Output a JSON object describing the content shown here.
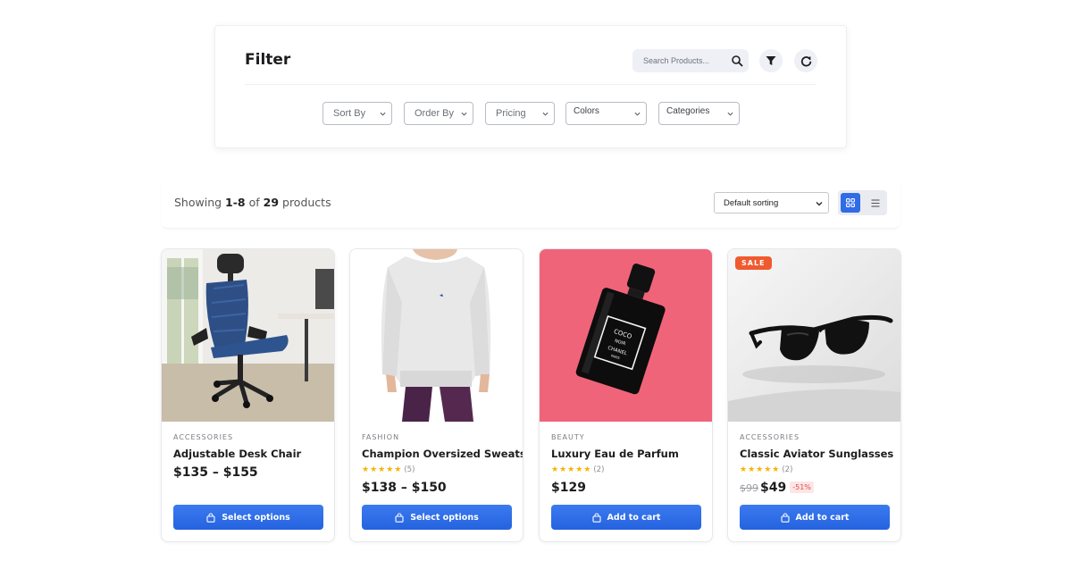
{
  "filter": {
    "title": "Filter",
    "search_placeholder": "Search Products...",
    "dropdowns": [
      "Sort By",
      "Order By",
      "Pricing",
      "Colors",
      "Categories"
    ]
  },
  "toolbar": {
    "showing_prefix": "Showing ",
    "range": "1-8",
    "of": " of ",
    "total": "29",
    "suffix": " products",
    "sort_value": "Default sorting",
    "active_view": "grid"
  },
  "products": [
    {
      "category": "ACCESSORIES",
      "title": "Adjustable Desk Chair",
      "price": "$135 – $155",
      "rating_stars": "",
      "rating_count": "",
      "cta": "Select options"
    },
    {
      "category": "FASHION",
      "title": "Champion Oversized Sweatshirt",
      "rating_stars": "★★★★★",
      "rating_count": "(5)",
      "price": "$138 – $150",
      "cta": "Select options"
    },
    {
      "category": "BEAUTY",
      "title": "Luxury Eau de Parfum",
      "rating_stars": "★★★★★",
      "rating_count": "(2)",
      "price": "$129",
      "cta": "Add to cart",
      "bottle_text": [
        "COCO",
        "NOIR",
        "CHANEL",
        "PARIS"
      ]
    },
    {
      "category": "ACCESSORIES",
      "title": "Classic Aviator Sunglasses",
      "rating_stars": "★★★★★",
      "rating_count": "(2)",
      "old_price": "$99",
      "price": "$49",
      "discount": "-51%",
      "badge": "SALE",
      "cta": "Add to cart"
    }
  ],
  "colors": {
    "accent": "#2f6ce6",
    "star": "#f5b301",
    "sale": "#f05a2f",
    "perfume_bg": "#f0647a"
  }
}
